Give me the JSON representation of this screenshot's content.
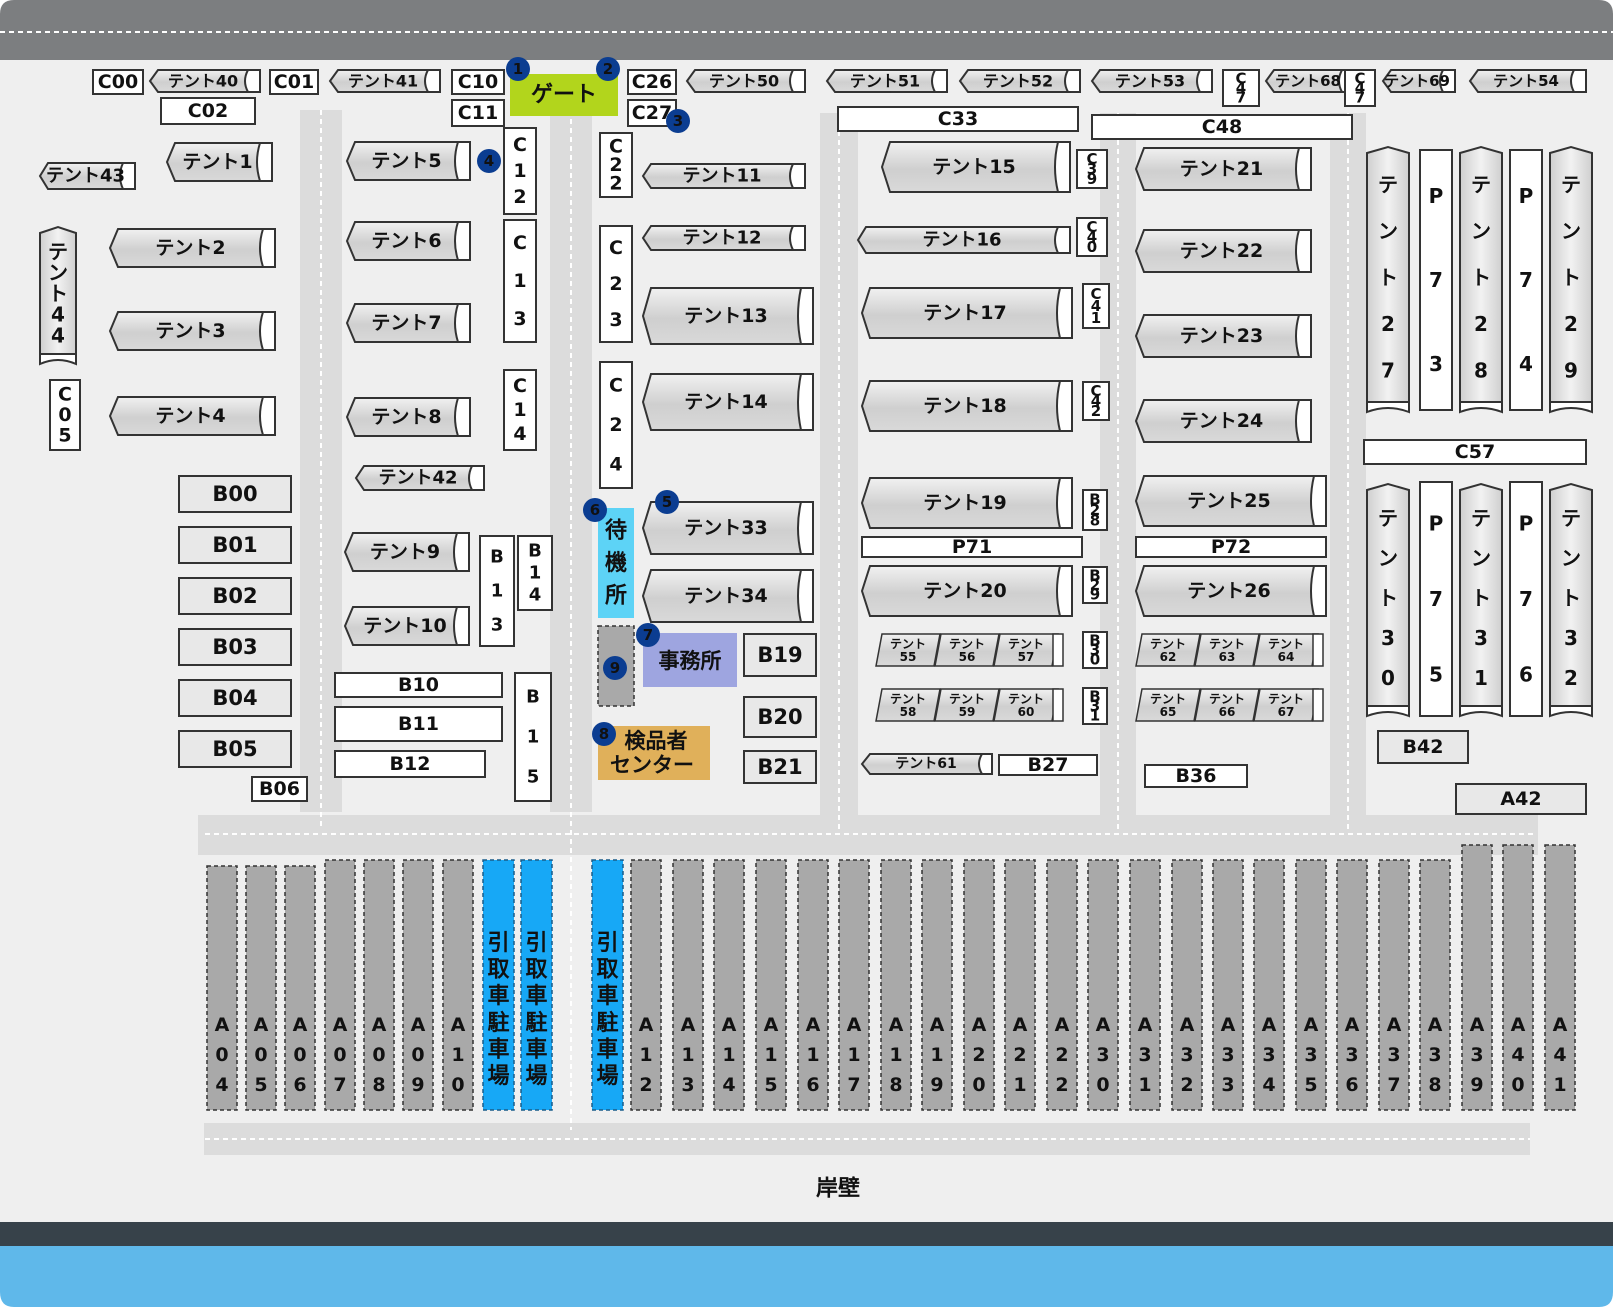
{
  "title": "岸壁",
  "colors": {
    "ground": "#efefef",
    "road": "#dcdcdc",
    "road_top": "#7c7e80",
    "sea": "#5fb8ea",
    "quay": "#37424a",
    "gate": "#b2d51c",
    "waiting": "#5dd3f6",
    "office": "#9ea5e0",
    "inspector": "#e0b05a",
    "parking": "#17a8f6",
    "badge": "#0b3d91"
  },
  "gate": "ゲート",
  "waiting_area": "待機所",
  "office": "事務所",
  "inspector_center": "検品者センター",
  "badges": [
    "1",
    "2",
    "3",
    "4",
    "5",
    "6",
    "7",
    "8",
    "9"
  ],
  "pickup_parking": "引取車駐車場",
  "small_boxes": [
    "C00",
    "C01",
    "C02",
    "C10",
    "C11",
    "C26",
    "C27",
    "C47",
    "C47",
    "B06",
    "B10",
    "B11",
    "B12",
    "B19",
    "B20",
    "B21",
    "B27",
    "B36",
    "B42",
    "A42",
    "B00",
    "B01",
    "B02",
    "B03",
    "B04",
    "B05"
  ],
  "vertical_boxes": [
    "C12",
    "C13",
    "C14",
    "C22",
    "C23",
    "C24",
    "C05",
    "B13",
    "B14",
    "B15",
    "B28",
    "B29",
    "B30",
    "B31",
    "C39",
    "C40",
    "C41",
    "C42",
    "P73",
    "P74",
    "P75",
    "P76"
  ],
  "bars": [
    "C33",
    "C48",
    "C57",
    "P71",
    "P72"
  ],
  "tents": [
    "テント1",
    "テント2",
    "テント3",
    "テント4",
    "テント5",
    "テント6",
    "テント7",
    "テント8",
    "テント9",
    "テント10",
    "テント11",
    "テント12",
    "テント13",
    "テント14",
    "テント15",
    "テント16",
    "テント17",
    "テント18",
    "テント19",
    "テント20",
    "テント21",
    "テント22",
    "テント23",
    "テント24",
    "テント25",
    "テント26",
    "テント33",
    "テント34",
    "テント40",
    "テント41",
    "テント42",
    "テント43",
    "テント50",
    "テント51",
    "テント52",
    "テント53",
    "テント54",
    "テント68",
    "テント69",
    "テント61"
  ],
  "tents_vertical": [
    "テント27",
    "テント28",
    "テント29",
    "テント30",
    "テント31",
    "テント32",
    "テント44"
  ],
  "tents_small": [
    "テント55",
    "テント56",
    "テント57",
    "テント58",
    "テント59",
    "テント60",
    "テント62",
    "テント63",
    "テント64",
    "テント65",
    "テント66",
    "テント67"
  ],
  "a_lots": [
    "A04",
    "A05",
    "A06",
    "A07",
    "A08",
    "A09",
    "A10",
    "A12",
    "A13",
    "A14",
    "A15",
    "A16",
    "A17",
    "A18",
    "A19",
    "A20",
    "A21",
    "A22",
    "A30",
    "A31",
    "A32",
    "A33",
    "A34",
    "A35",
    "A36",
    "A37",
    "A38",
    "A39",
    "A40",
    "A41"
  ]
}
